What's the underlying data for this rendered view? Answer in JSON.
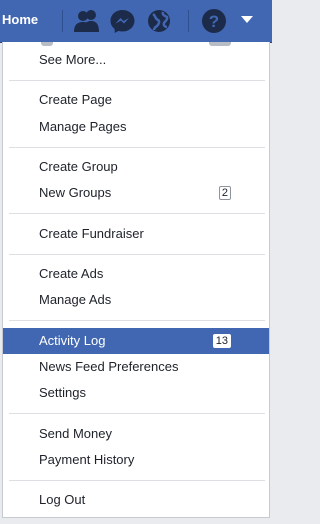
{
  "topbar": {
    "home_label": "Home",
    "icons": {
      "friends": "friend-requests-icon",
      "messages": "messenger-icon",
      "notifications": "globe-icon",
      "help": "help-icon",
      "account": "account-menu-caret-icon"
    },
    "bg_color": "#4267b2"
  },
  "menu": {
    "items": [
      {
        "label": "See More..."
      },
      {
        "label": "Create Page"
      },
      {
        "label": "Manage Pages"
      },
      {
        "label": "Create Group"
      },
      {
        "label": "New Groups",
        "badge": "2"
      },
      {
        "label": "Create Fundraiser"
      },
      {
        "label": "Create Ads"
      },
      {
        "label": "Manage Ads"
      },
      {
        "label": "Activity Log",
        "badge": "13",
        "active": true
      },
      {
        "label": "News Feed Preferences"
      },
      {
        "label": "Settings"
      },
      {
        "label": "Send Money"
      },
      {
        "label": "Payment History"
      },
      {
        "label": "Log Out"
      }
    ],
    "active_color": "#4267b2"
  }
}
